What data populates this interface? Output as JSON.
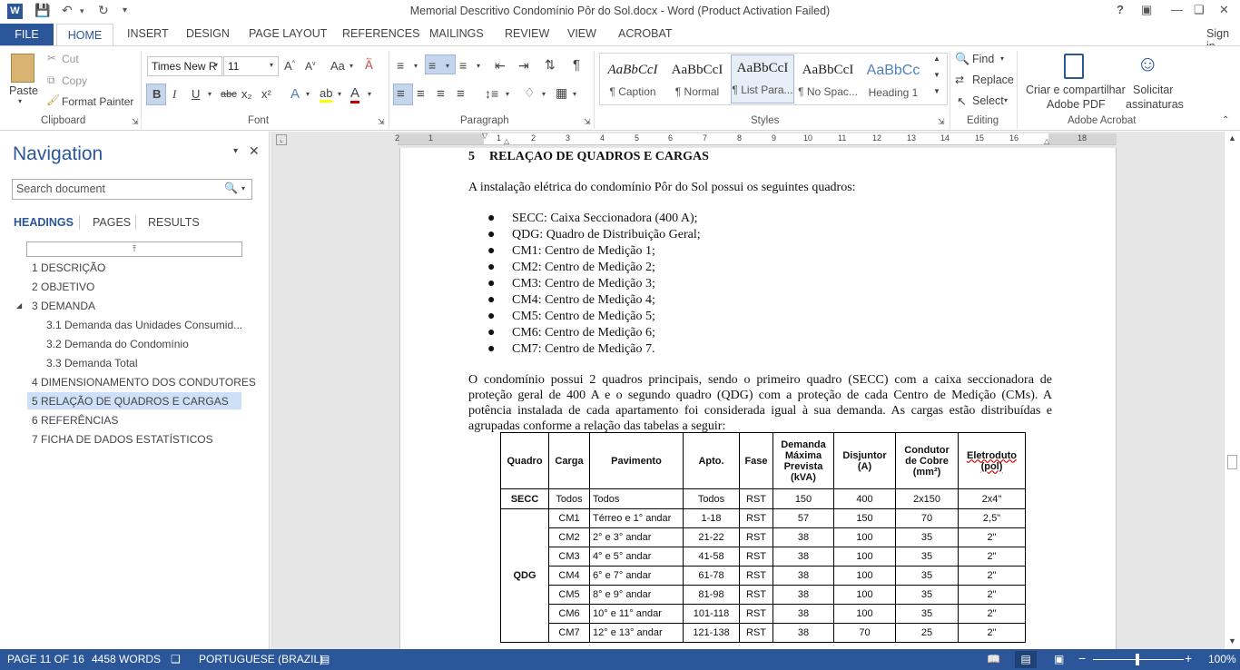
{
  "window": {
    "title": "Memorial Descritivo Condomínio Pôr do Sol.docx - Word (Product Activation Failed)",
    "help": "?",
    "sign_in": "Sign in"
  },
  "tabs": [
    "FILE",
    "HOME",
    "INSERT",
    "DESIGN",
    "PAGE LAYOUT",
    "REFERENCES",
    "MAILINGS",
    "REVIEW",
    "VIEW",
    "ACROBAT"
  ],
  "ribbon": {
    "clipboard": {
      "paste": "Paste",
      "cut": "Cut",
      "copy": "Copy",
      "format_painter": "Format Painter",
      "label": "Clipboard"
    },
    "font": {
      "family": "Times New R",
      "size": "11",
      "bold": "B",
      "italic": "I",
      "underline": "U",
      "strike": "abc",
      "subscript": "x₂",
      "superscript": "x²",
      "label": "Font",
      "change_case": "Aa"
    },
    "paragraph": {
      "label": "Paragraph",
      "pilcrow": "¶"
    },
    "styles": {
      "label": "Styles",
      "items": [
        {
          "preview": "AaBbCcI",
          "name": "¶ Caption"
        },
        {
          "preview": "AaBbCcI",
          "name": "¶ Normal"
        },
        {
          "preview": "AaBbCcI",
          "name": "¶ List Para..."
        },
        {
          "preview": "AaBbCcI",
          "name": "¶ No Spac..."
        },
        {
          "preview": "AaBbCc",
          "name": "Heading 1"
        }
      ]
    },
    "editing": {
      "find": "Find",
      "replace": "Replace",
      "select": "Select",
      "label": "Editing"
    },
    "acrobat": {
      "create": "Criar e compartilhar",
      "create2": "Adobe PDF",
      "request": "Solicitar",
      "request2": "assinaturas",
      "label": "Adobe Acrobat"
    }
  },
  "nav": {
    "title": "Navigation",
    "search_placeholder": "Search document",
    "tabs": [
      "HEADINGS",
      "PAGES",
      "RESULTS"
    ],
    "headings": [
      "1 DESCRIÇÃO",
      "2 OBJETIVO",
      "3 DEMANDA",
      "3.1 Demanda das Unidades Consumid...",
      "3.2 Demanda do Condomínio",
      "3.3 Demanda Total",
      "4 DIMENSIONAMENTO DOS CONDUTORES",
      "5 RELAÇÃO DE QUADROS E CARGAS",
      "6 REFERÊNCIAS",
      "7 FICHA DE DADOS ESTATÍSTICOS"
    ]
  },
  "ruler": [
    "2",
    "1",
    "1",
    "2",
    "3",
    "4",
    "5",
    "6",
    "7",
    "8",
    "9",
    "10",
    "11",
    "12",
    "13",
    "14",
    "15",
    "16",
    "18"
  ],
  "document": {
    "heading_num": "5",
    "heading": "RELAÇAO DE QUADROS E CARGAS",
    "intro": "A instalação elétrica do condomínio Pôr do Sol possui os seguintes quadros:",
    "bullets": [
      "SECC: Caixa Seccionadora (400 A);",
      "QDG: Quadro de Distribuição Geral;",
      "CM1: Centro de Medição 1;",
      "CM2: Centro de Medição 2;",
      "CM3: Centro de Medição 3;",
      "CM4: Centro de Medição 4;",
      "CM5: Centro de Medição 5;",
      "CM6: Centro de Medição 6;",
      "CM7: Centro de Medição 7."
    ],
    "paragraph_lines": [
      "O condomínio possui 2 quadros principais, sendo o primeiro quadro (SECC) com a caixa seccionadora de",
      "proteção geral de 400 A e o segundo quadro (QDG) com a proteção de cada Centro de Medição (CMs). A",
      "potência instalada de cada apartamento foi considerada igual à sua demanda. As cargas estão distribuídas e",
      "agrupadas conforme a relação das tabelas a seguir:"
    ],
    "table": {
      "headers": [
        "Quadro",
        "Carga",
        "Pavimento",
        "Apto.",
        "Fase",
        "Demanda Máxima Prevista (kVA)",
        "Disjuntor (A)",
        "Condutor de Cobre (mm²)",
        "Eletroduto (pol)"
      ],
      "secc_row": [
        "SECC",
        "Todos",
        "Todos",
        "Todos",
        "RST",
        "150",
        "400",
        "2x150",
        "2x4\""
      ],
      "qdg_label": "QDG",
      "qdg_rows": [
        [
          "CM1",
          "Térreo e 1° andar",
          "1-18",
          "RST",
          "57",
          "150",
          "70",
          "2,5\""
        ],
        [
          "CM2",
          "2° e 3° andar",
          "21-22",
          "RST",
          "38",
          "100",
          "35",
          "2\""
        ],
        [
          "CM3",
          "4° e 5° andar",
          "41-58",
          "RST",
          "38",
          "100",
          "35",
          "2\""
        ],
        [
          "CM4",
          "6° e 7° andar",
          "61-78",
          "RST",
          "38",
          "100",
          "35",
          "2\""
        ],
        [
          "CM5",
          "8° e 9° andar",
          "81-98",
          "RST",
          "38",
          "100",
          "35",
          "2\""
        ],
        [
          "CM6",
          "10° e 11° andar",
          "101-118",
          "RST",
          "38",
          "100",
          "35",
          "2\""
        ],
        [
          "CM7",
          "12° e 13° andar",
          "121-138",
          "RST",
          "38",
          "70",
          "25",
          "2\""
        ]
      ]
    }
  },
  "status": {
    "page": "PAGE 11 OF 16",
    "words": "4458 WORDS",
    "language": "PORTUGUESE (BRAZIL)",
    "zoom": "100%"
  }
}
